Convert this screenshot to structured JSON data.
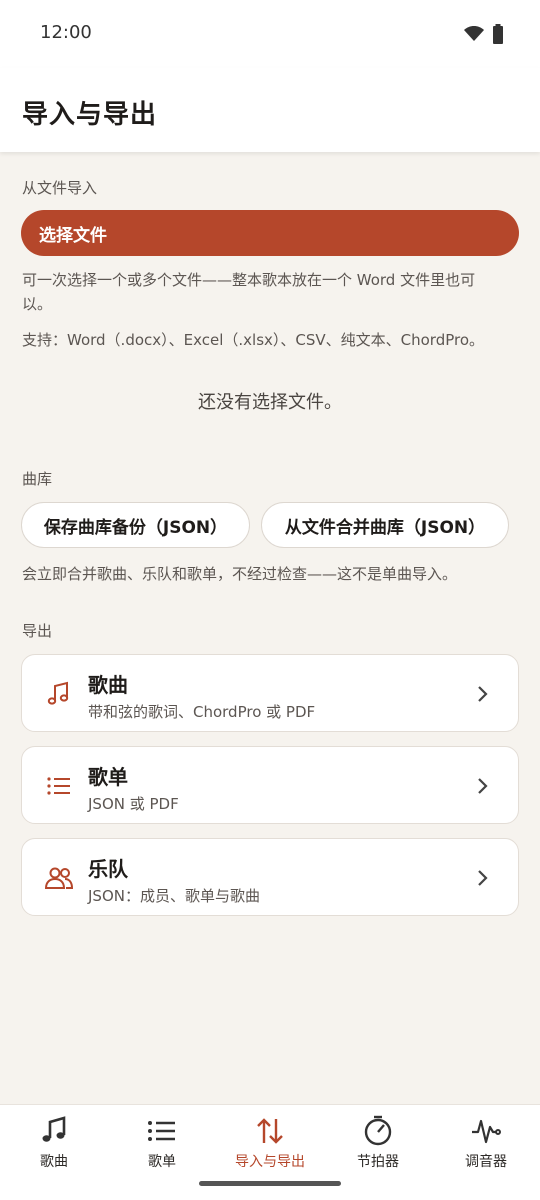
{
  "status": {
    "time": "12:00"
  },
  "app_bar": {
    "title": "导入与导出"
  },
  "import": {
    "section_label": "从文件导入",
    "choose_button": "选择文件",
    "help_multi": "可一次选择一个或多个文件——整本歌本放在一个 Word 文件里也可以。",
    "help_formats": "支持：Word（.docx）、Excel（.xlsx）、CSV、纯文本、ChordPro。",
    "empty_note": "还没有选择文件。"
  },
  "library": {
    "section_label": "曲库",
    "backup_button": "保存曲库备份（JSON）",
    "merge_button": "从文件合并曲库（JSON）",
    "note": "会立即合并歌曲、乐队和歌单，不经过检查——这不是单曲导入。"
  },
  "export": {
    "section_label": "导出",
    "items": [
      {
        "title": "歌曲",
        "subtitle": "带和弦的歌词、ChordPro 或 PDF",
        "icon": "music-note-icon"
      },
      {
        "title": "歌单",
        "subtitle": "JSON 或 PDF",
        "icon": "list-icon"
      },
      {
        "title": "乐队",
        "subtitle": "JSON：成员、歌单与歌曲",
        "icon": "people-icon"
      }
    ]
  },
  "bottom_nav": {
    "items": [
      {
        "label": "歌曲",
        "icon": "music-note-icon",
        "active": false
      },
      {
        "label": "歌单",
        "icon": "list-icon",
        "active": false
      },
      {
        "label": "导入与导出",
        "icon": "import-export-icon",
        "active": true
      },
      {
        "label": "节拍器",
        "icon": "metronome-icon",
        "active": false
      },
      {
        "label": "调音器",
        "icon": "tuner-icon",
        "active": false
      }
    ]
  },
  "colors": {
    "accent": "#b5472b",
    "background": "#f6f3ee",
    "surface": "#ffffff",
    "text": "#1f1c1a",
    "muted": "#5c5652"
  }
}
